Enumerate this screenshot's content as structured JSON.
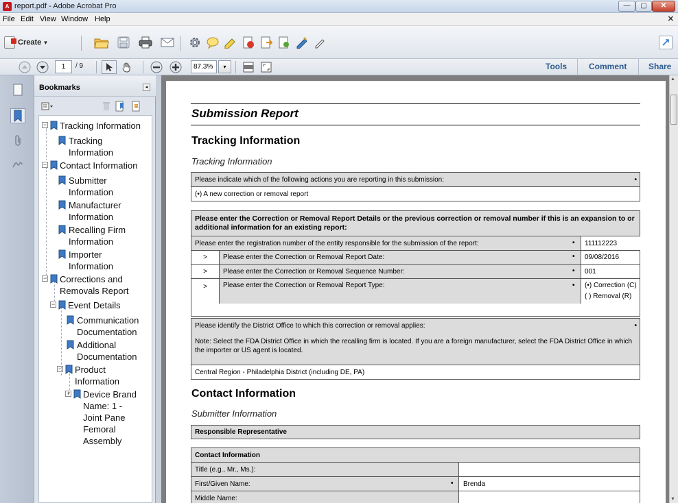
{
  "window": {
    "title": "report.pdf - Adobe Acrobat Pro",
    "app_icon_label": "A"
  },
  "menu": [
    "File",
    "Edit",
    "View",
    "Window",
    "Help"
  ],
  "toolbar": {
    "create_label": "Create",
    "create_arrow": "▾"
  },
  "nav": {
    "page_current": "1",
    "page_total": "/ 9",
    "zoom": "87.3%",
    "zoom_arrow": "▾"
  },
  "right_tabs": [
    "Tools",
    "Comment",
    "Share"
  ],
  "bookmarks": {
    "title": "Bookmarks",
    "items": [
      {
        "label": [
          "Tracking Information"
        ],
        "expander": "⊟"
      },
      {
        "label": [
          "Tracking",
          "Information"
        ]
      },
      {
        "label": [
          "Contact Information"
        ],
        "expander": "⊟"
      },
      {
        "label": [
          "Submitter",
          "Information"
        ]
      },
      {
        "label": [
          "Manufacturer",
          "Information"
        ]
      },
      {
        "label": [
          "Recalling Firm",
          "Information"
        ]
      },
      {
        "label": [
          "Importer",
          "Information"
        ]
      },
      {
        "label": [
          "Corrections and",
          "Removals Report"
        ],
        "expander": "⊟"
      },
      {
        "label": [
          "Event Details"
        ],
        "expander": "⊟"
      },
      {
        "label": [
          "Communication",
          "Documentation"
        ]
      },
      {
        "label": [
          "Additional",
          "Documentation"
        ]
      },
      {
        "label": [
          "Product",
          "Information"
        ],
        "expander": "⊟"
      },
      {
        "label": [
          "Device Brand",
          "Name: 1 -",
          "Joint Pane",
          "Femoral",
          "Assembly"
        ],
        "expander": "⊞"
      }
    ]
  },
  "doc": {
    "title": "Submission Report",
    "tracking": {
      "heading": "Tracking Information",
      "subheading": "Tracking Information",
      "q1": "Please indicate which of the following actions you are reporting in this submission:",
      "a1": "(•)  A new correction or removal report",
      "q2": "Please enter the Correction or Removal Report Details or the previous correction or removal number if this is an expansion to or additional information for an existing report:",
      "reg_q": "Please enter the registration number of the entity responsible for the submission of the report:",
      "reg_a": "111112223",
      "date_q": "Please enter the Correction or Removal Report Date:",
      "date_a": "09/08/2016",
      "seq_q": "Please enter the Correction or Removal Sequence Number:",
      "seq_a": "001",
      "type_q": "Please enter the Correction or Removal Report Type:",
      "type_a1": "(•)  Correction (C)",
      "type_a2": "(  )  Removal (R)",
      "arrow": ">",
      "bullet": "•",
      "district_q": "Please identify the District Office to which this correction or removal applies:",
      "district_note": "Note: Select the FDA District Office in which the recalling firm is located. If you are a foreign manufacturer, select the FDA District Office in which the importer or US agent is located.",
      "district_a": "Central Region - Philadelphia District (including DE, PA)"
    },
    "contact": {
      "heading": "Contact Information",
      "subheading": "Submitter Information",
      "rep": "Responsible Representative",
      "table_head": "Contact Information",
      "title_label": "Title (e.g., Mr., Ms.):",
      "first_label": "First/Given Name:",
      "first_value": "Brenda",
      "middle_label": "Middle Name:"
    }
  }
}
